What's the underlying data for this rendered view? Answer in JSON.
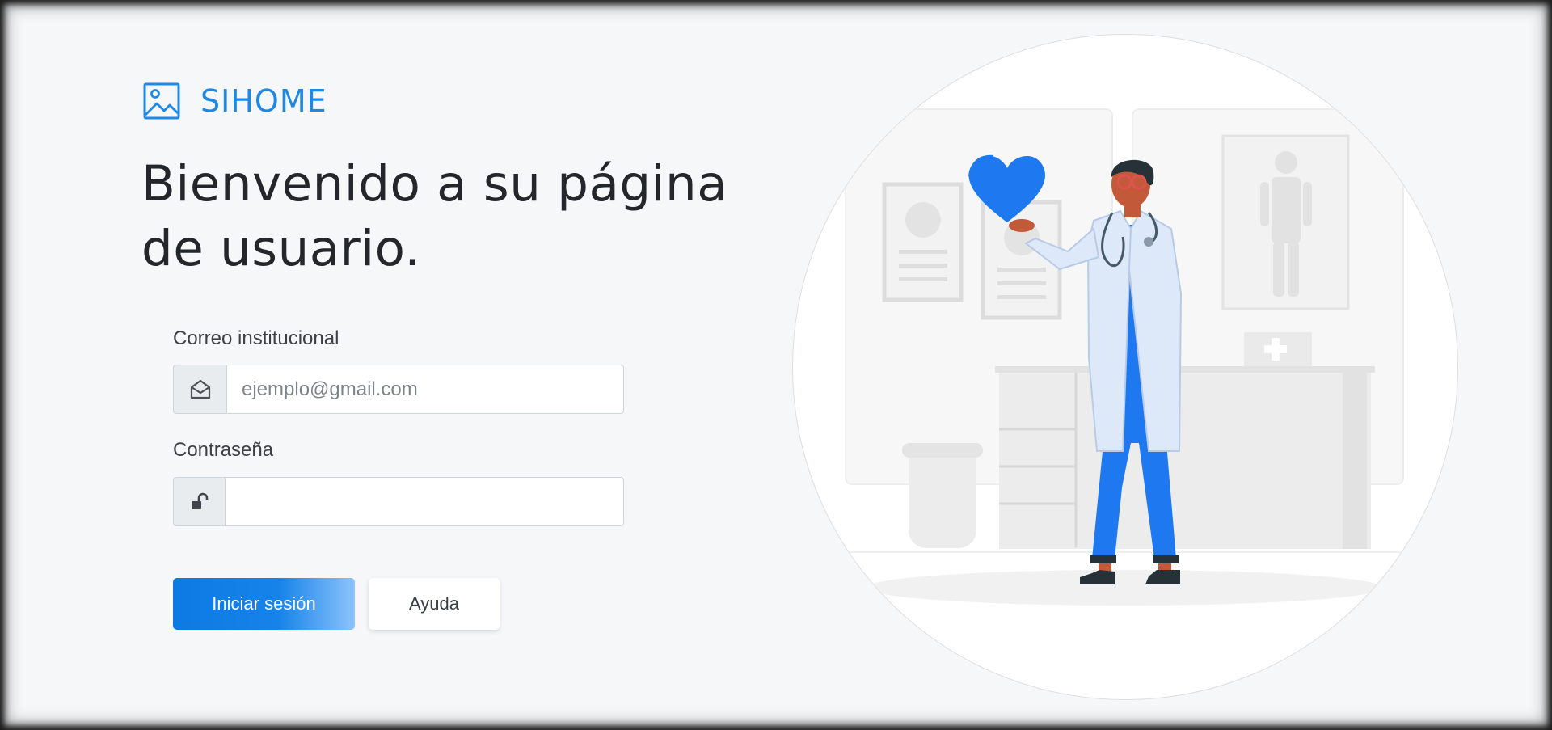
{
  "brand": {
    "logo_icon": "image-icon",
    "name": "SIHOME",
    "color": "#1e88e5"
  },
  "headline": {
    "line1": "Bienvenido a su página",
    "line2": "de usuario."
  },
  "form": {
    "email": {
      "label": "Correo institucional",
      "placeholder": "ejemplo@gmail.com",
      "value": "",
      "icon": "envelope-open-icon"
    },
    "password": {
      "label": "Contraseña",
      "placeholder": "",
      "value": "",
      "icon": "unlock-icon"
    },
    "submit_label": "Iniciar sesión",
    "help_label": "Ayuda"
  },
  "illustration": {
    "subject": "doctor-holding-heart-illustration"
  }
}
